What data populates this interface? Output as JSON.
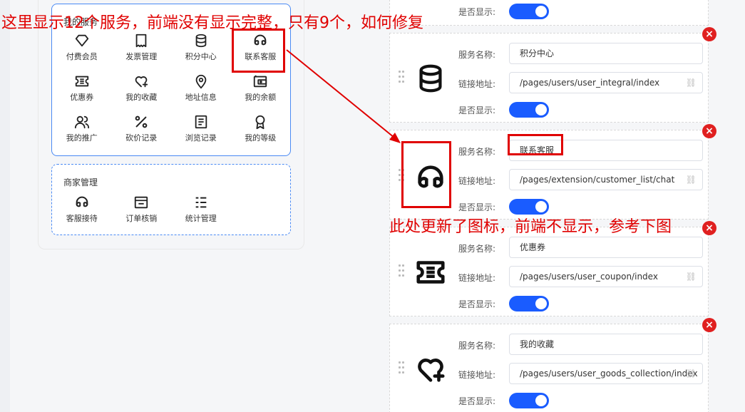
{
  "annotations": {
    "top_note": "这里显示12个服务，前端没有显示完整，只有9个，如何修复",
    "middle_note": "此处更新了图标，前端不显示，参考下图"
  },
  "preview": {
    "my_services": {
      "title": "我的服务",
      "items": [
        {
          "label": "付费会员",
          "icon": "diamond-icon"
        },
        {
          "label": "发票管理",
          "icon": "receipt-icon"
        },
        {
          "label": "积分中心",
          "icon": "database-icon"
        },
        {
          "label": "联系客服",
          "icon": "headset-icon"
        },
        {
          "label": "优惠券",
          "icon": "coupon-icon"
        },
        {
          "label": "我的收藏",
          "icon": "heart-plus-icon"
        },
        {
          "label": "地址信息",
          "icon": "location-icon"
        },
        {
          "label": "我的余额",
          "icon": "wallet-icon"
        },
        {
          "label": "我的推广",
          "icon": "users-icon"
        },
        {
          "label": "砍价记录",
          "icon": "percent-icon"
        },
        {
          "label": "浏览记录",
          "icon": "document-icon"
        },
        {
          "label": "我的等级",
          "icon": "award-icon"
        }
      ]
    },
    "merchant": {
      "title": "商家管理",
      "items": [
        {
          "label": "客服接待",
          "icon": "headset-icon"
        },
        {
          "label": "订单核销",
          "icon": "order-check-icon"
        },
        {
          "label": "统计管理",
          "icon": "list-icon"
        }
      ]
    }
  },
  "editor": {
    "labels": {
      "name": "服务名称:",
      "link": "链接地址:",
      "show": "是否显示:"
    },
    "delete_glyph": "×",
    "link_glyph": "⛓",
    "cards": [
      {
        "name": "积分中心",
        "link": "/pages/users/user_integral/index",
        "icon": "database-icon",
        "show": true
      },
      {
        "name": "联系客服",
        "link": "/pages/extension/customer_list/chat",
        "icon": "headset-icon",
        "show": true
      },
      {
        "name": "优惠券",
        "link": "/pages/users/user_coupon/index",
        "icon": "coupon-icon",
        "show": true
      },
      {
        "name": "我的收藏",
        "link": "/pages/users/user_goods_collection/index",
        "icon": "heart-plus-icon",
        "show": true
      }
    ]
  },
  "colors": {
    "accent": "#1a5cff",
    "annotation": "#e00000",
    "border": "#4a8af4"
  }
}
